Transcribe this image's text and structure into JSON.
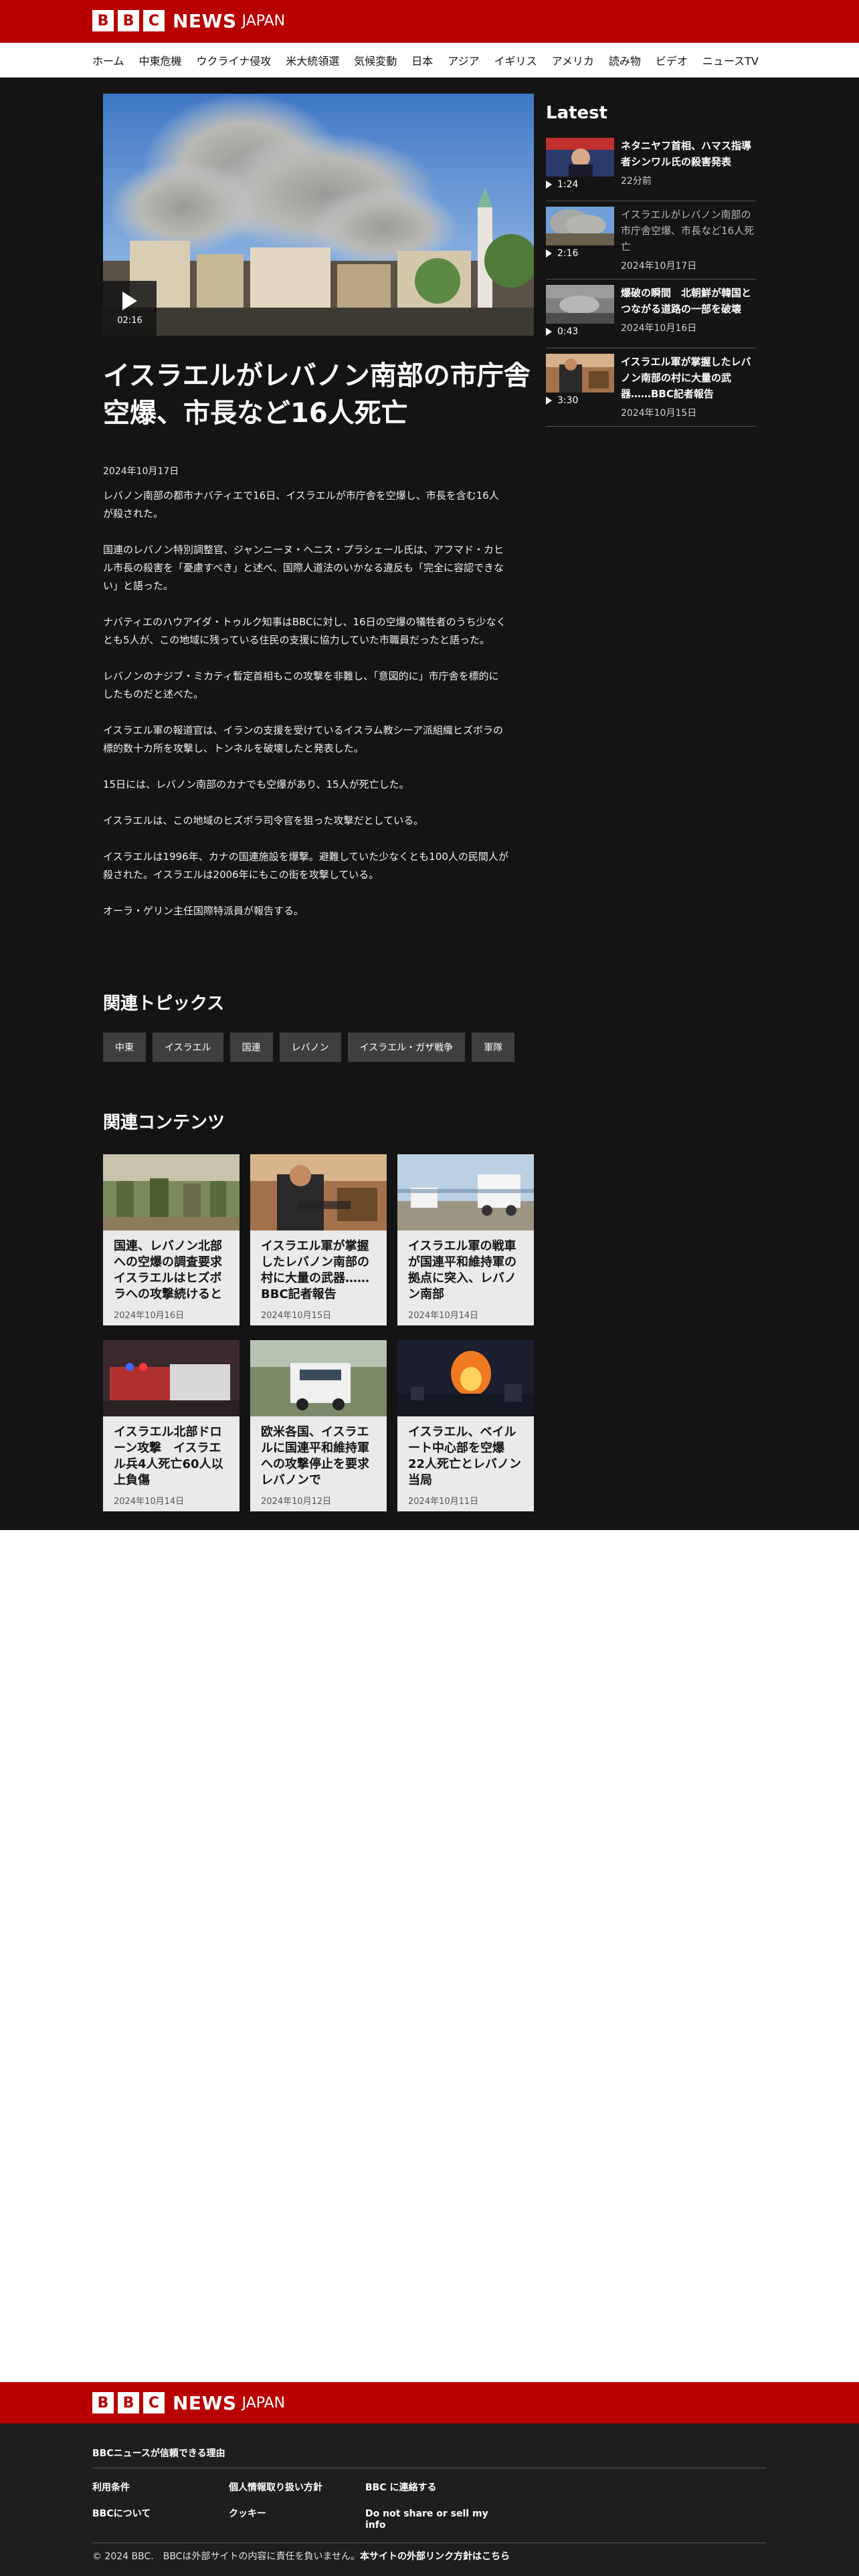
{
  "header": {
    "logo_letters": [
      "B",
      "B",
      "C"
    ],
    "brand_news": "NEWS",
    "brand_region": "JAPAN",
    "brand_color": "#b80000"
  },
  "nav": {
    "items": [
      "ホーム",
      "中東危機",
      "ウクライナ侵攻",
      "米大統領選",
      "気候変動",
      "日本",
      "アジア",
      "イギリス",
      "アメリカ",
      "読み物",
      "ビデオ",
      "ニュースTV"
    ]
  },
  "article": {
    "video_duration": "02:16",
    "headline": "イスラエルがレバノン南部の市庁舎空爆、市長など16人死亡",
    "date": "2024年10月17日",
    "paragraphs": [
      "レバノン南部の都市ナバティエで16日、イスラエルが市庁舎を空爆し、市長を含む16人が殺された。",
      "国連のレバノン特別調整官、ジャンニーヌ・ヘニス・プラシェール氏は、アフマド・カヒル市長の殺害を「憂慮すべき」と述べ、国際人道法のいかなる違反も「完全に容認できない」と語った。",
      "ナバティエのハウアイダ・トゥルク知事はBBCに対し、16日の空爆の犠牲者のうち少なくとも5人が、この地域に残っている住民の支援に協力していた市職員だったと語った。",
      "レバノンのナジブ・ミカティ暫定首相もこの攻撃を非難し、「意図的に」市庁舎を標的にしたものだと述べた。",
      "イスラエル軍の報道官は、イランの支援を受けているイスラム教シーア派組織ヒズボラの標的数十カ所を攻撃し、トンネルを破壊したと発表した。",
      "15日には、レバノン南部のカナでも空爆があり、15人が死亡した。",
      "イスラエルは、この地域のヒズボラ司令官を狙った攻撃だとしている。",
      "イスラエルは1996年、カナの国連施設を爆撃。避難していた少なくとも100人の民間人が殺された。イスラエルは2006年にもこの街を攻撃している。",
      "オーラ・ゲリン主任国際特派員が報告する。"
    ]
  },
  "topics": {
    "title": "関連トピックス",
    "items": [
      "中東",
      "イスラエル",
      "国連",
      "レバノン",
      "イスラエル・ガザ戦争",
      "軍隊"
    ]
  },
  "related": {
    "title": "関連コンテンツ",
    "cards": [
      {
        "title": "国連、レバノン北部への空爆の調査要求　イスラエルはヒズボラへの攻撃続けると",
        "date": "2024年10月16日"
      },
      {
        "title": "イスラエル軍が掌握したレバノン南部の村に大量の武器……BBC記者報告",
        "date": "2024年10月15日"
      },
      {
        "title": "イスラエル軍の戦車が国連平和維持軍の拠点に突入、レバノン南部",
        "date": "2024年10月14日"
      },
      {
        "title": "イスラエル北部ドローン攻撃　イスラエル兵4人死亡60人以上負傷",
        "date": "2024年10月14日"
      },
      {
        "title": "欧米各国、イスラエルに国連平和維持軍への攻撃停止を要求　レバノンで",
        "date": "2024年10月12日"
      },
      {
        "title": "イスラエル、ベイルート中心部を空爆　22人死亡とレバノン当局",
        "date": "2024年10月11日"
      }
    ]
  },
  "latest": {
    "title": "Latest",
    "items": [
      {
        "duration": "1:24",
        "title": "ネタニヤフ首相、ハマス指導者シンワル氏の殺害発表",
        "date": "22分前",
        "dim": false
      },
      {
        "duration": "2:16",
        "title": "イスラエルがレバノン南部の市庁舎空爆、市長など16人死亡",
        "date": "2024年10月17日",
        "dim": true
      },
      {
        "duration": "0:43",
        "title": "爆破の瞬間　北朝鮮が韓国とつながる道路の一部を破壊",
        "date": "2024年10月16日",
        "dim": false
      },
      {
        "duration": "3:30",
        "title": "イスラエル軍が掌握したレバノン南部の村に大量の武器……BBC記者報告",
        "date": "2024年10月15日",
        "dim": false
      }
    ]
  },
  "footer": {
    "trust_link": "BBCニュースが信頼できる理由",
    "links": [
      "利用条件",
      "個人情報取り扱い方針",
      "BBC に連絡する",
      "BBCについて",
      "クッキー",
      "Do not share or sell my info"
    ],
    "copyright": "© 2024 BBC.　BBCは外部サイトの内容に責任を負いません。",
    "external_link_policy": "本サイトの外部リンク方針はこちら"
  }
}
